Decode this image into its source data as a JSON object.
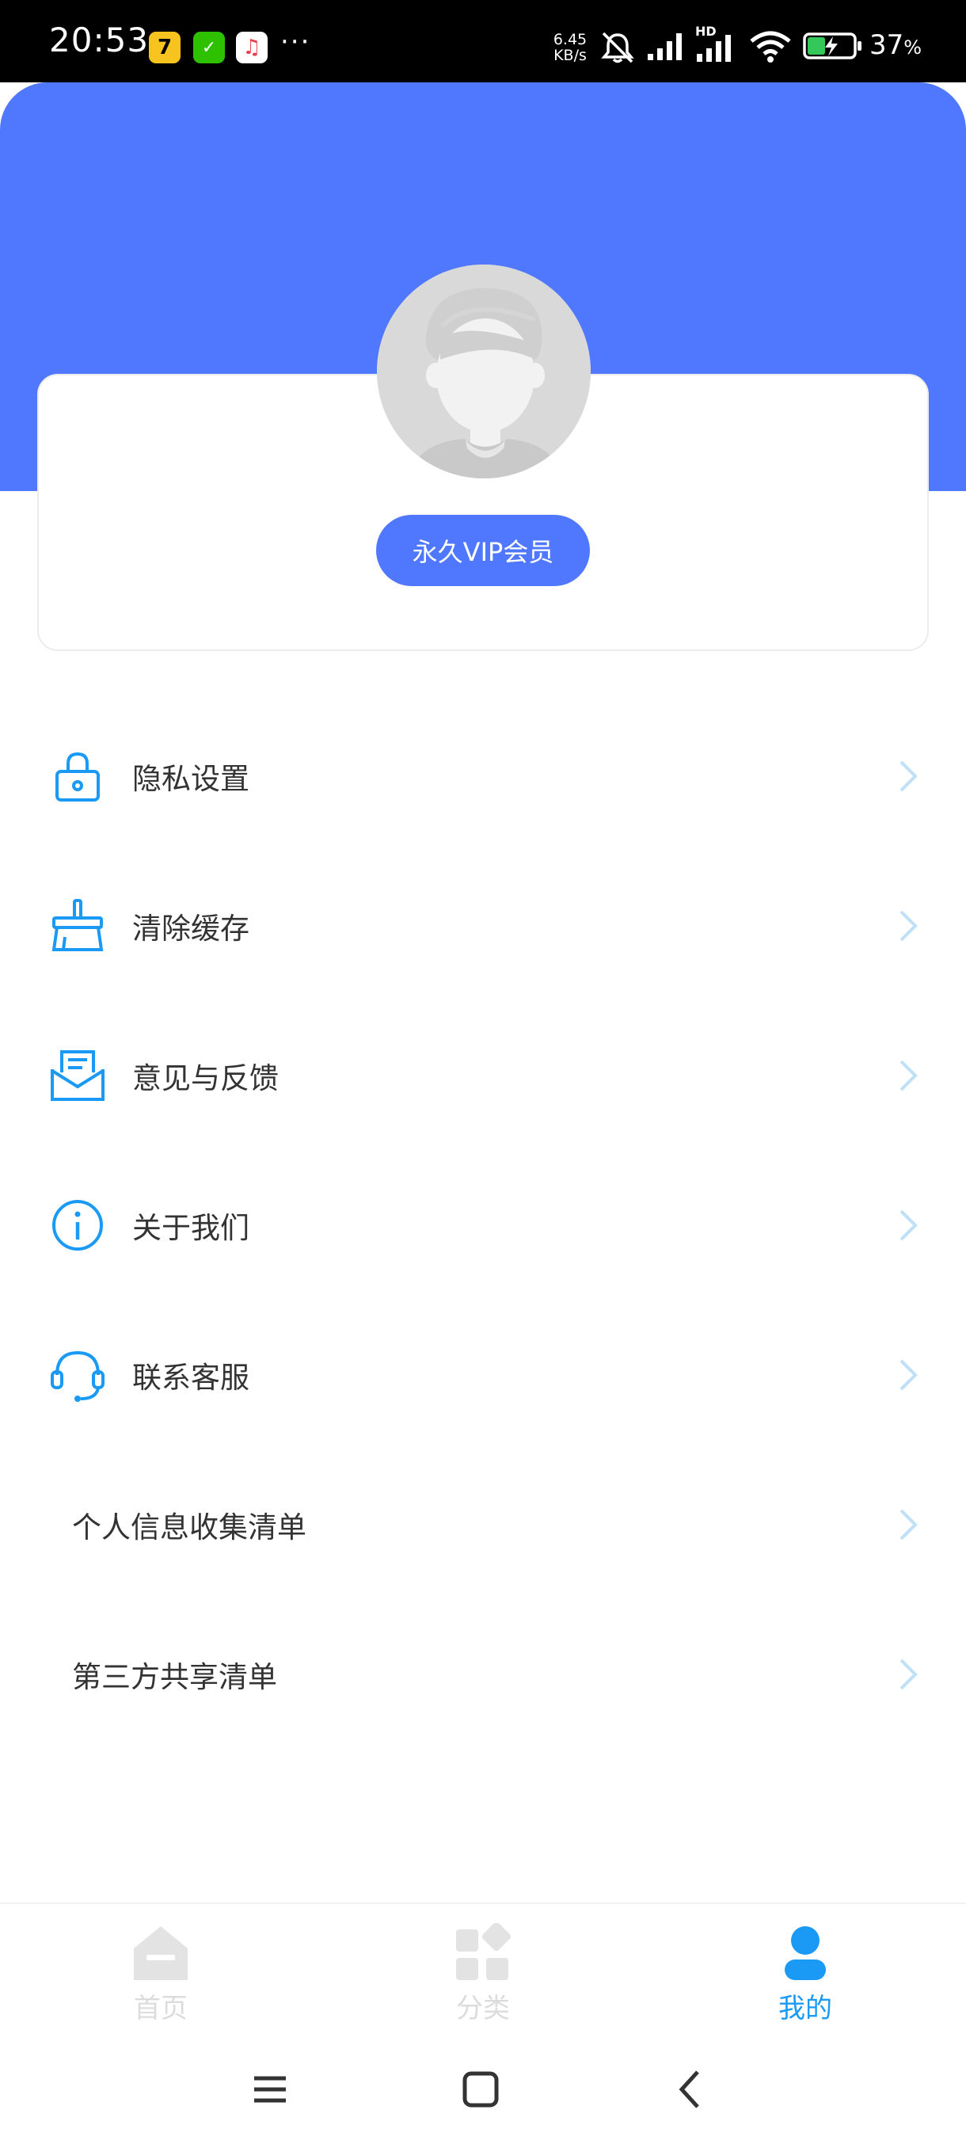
{
  "status_bar": {
    "time": "20:53",
    "app_icon_1": "7",
    "app_icon_2": "✓",
    "app_icon_3": "♫",
    "more": "···",
    "net_speed_value": "6.45",
    "net_speed_unit": "KB/s",
    "signal_hd_label": "HD",
    "battery_percent": "37",
    "battery_percent_sign": "%"
  },
  "profile": {
    "vip_label": "永久VIP会员"
  },
  "menu": {
    "items": [
      {
        "label": "隐私设置",
        "icon": "lock-icon"
      },
      {
        "label": "清除缓存",
        "icon": "broom-icon"
      },
      {
        "label": "意见与反馈",
        "icon": "mail-icon"
      },
      {
        "label": "关于我们",
        "icon": "info-icon"
      },
      {
        "label": "联系客服",
        "icon": "headset-icon"
      },
      {
        "label": "个人信息收集清单",
        "icon": ""
      },
      {
        "label": "第三方共享清单",
        "icon": ""
      }
    ]
  },
  "bottom_nav": {
    "items": [
      {
        "label": "首页",
        "icon": "home-icon",
        "active": false
      },
      {
        "label": "分类",
        "icon": "category-icon",
        "active": false
      },
      {
        "label": "我的",
        "icon": "user-icon",
        "active": true
      }
    ]
  },
  "colors": {
    "header_blue": "#4f78ff",
    "icon_blue": "#1a9af5",
    "chevron": "#bfe0f7",
    "inactive_nav": "#dcdcdc"
  }
}
